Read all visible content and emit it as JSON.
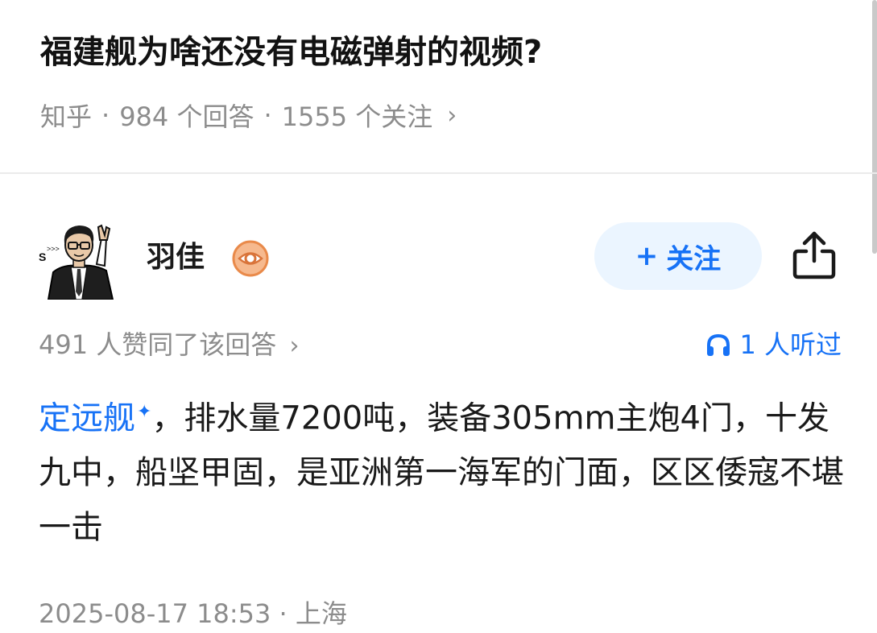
{
  "question": {
    "title": "福建舰为啥还没有电磁弹射的视频?",
    "source": "知乎",
    "answers": "984 个回答",
    "followers": "1555 个关注",
    "separator": "·"
  },
  "author": {
    "name": "羽佳",
    "avatar_icon": "cartoon-avatar-icon",
    "badge_icon": "eye-badge-icon",
    "follow_label": "关注",
    "follow_prefix": "+"
  },
  "stats": {
    "likes": "491 人赞同了该回答",
    "listened": "1 人听过"
  },
  "answer": {
    "link_text": "定远舰",
    "body": "，排水量7200吨，装备305mm主炮4门，十发九中，船坚甲固，是亚洲第一海军的门面，区区倭寇不堪一击"
  },
  "footer": {
    "meta": "2025-08-17 18:53 · 上海"
  },
  "colors": {
    "accent": "#1772f6",
    "muted": "#8c8c8c",
    "follow_bg": "#ebf5ff"
  }
}
